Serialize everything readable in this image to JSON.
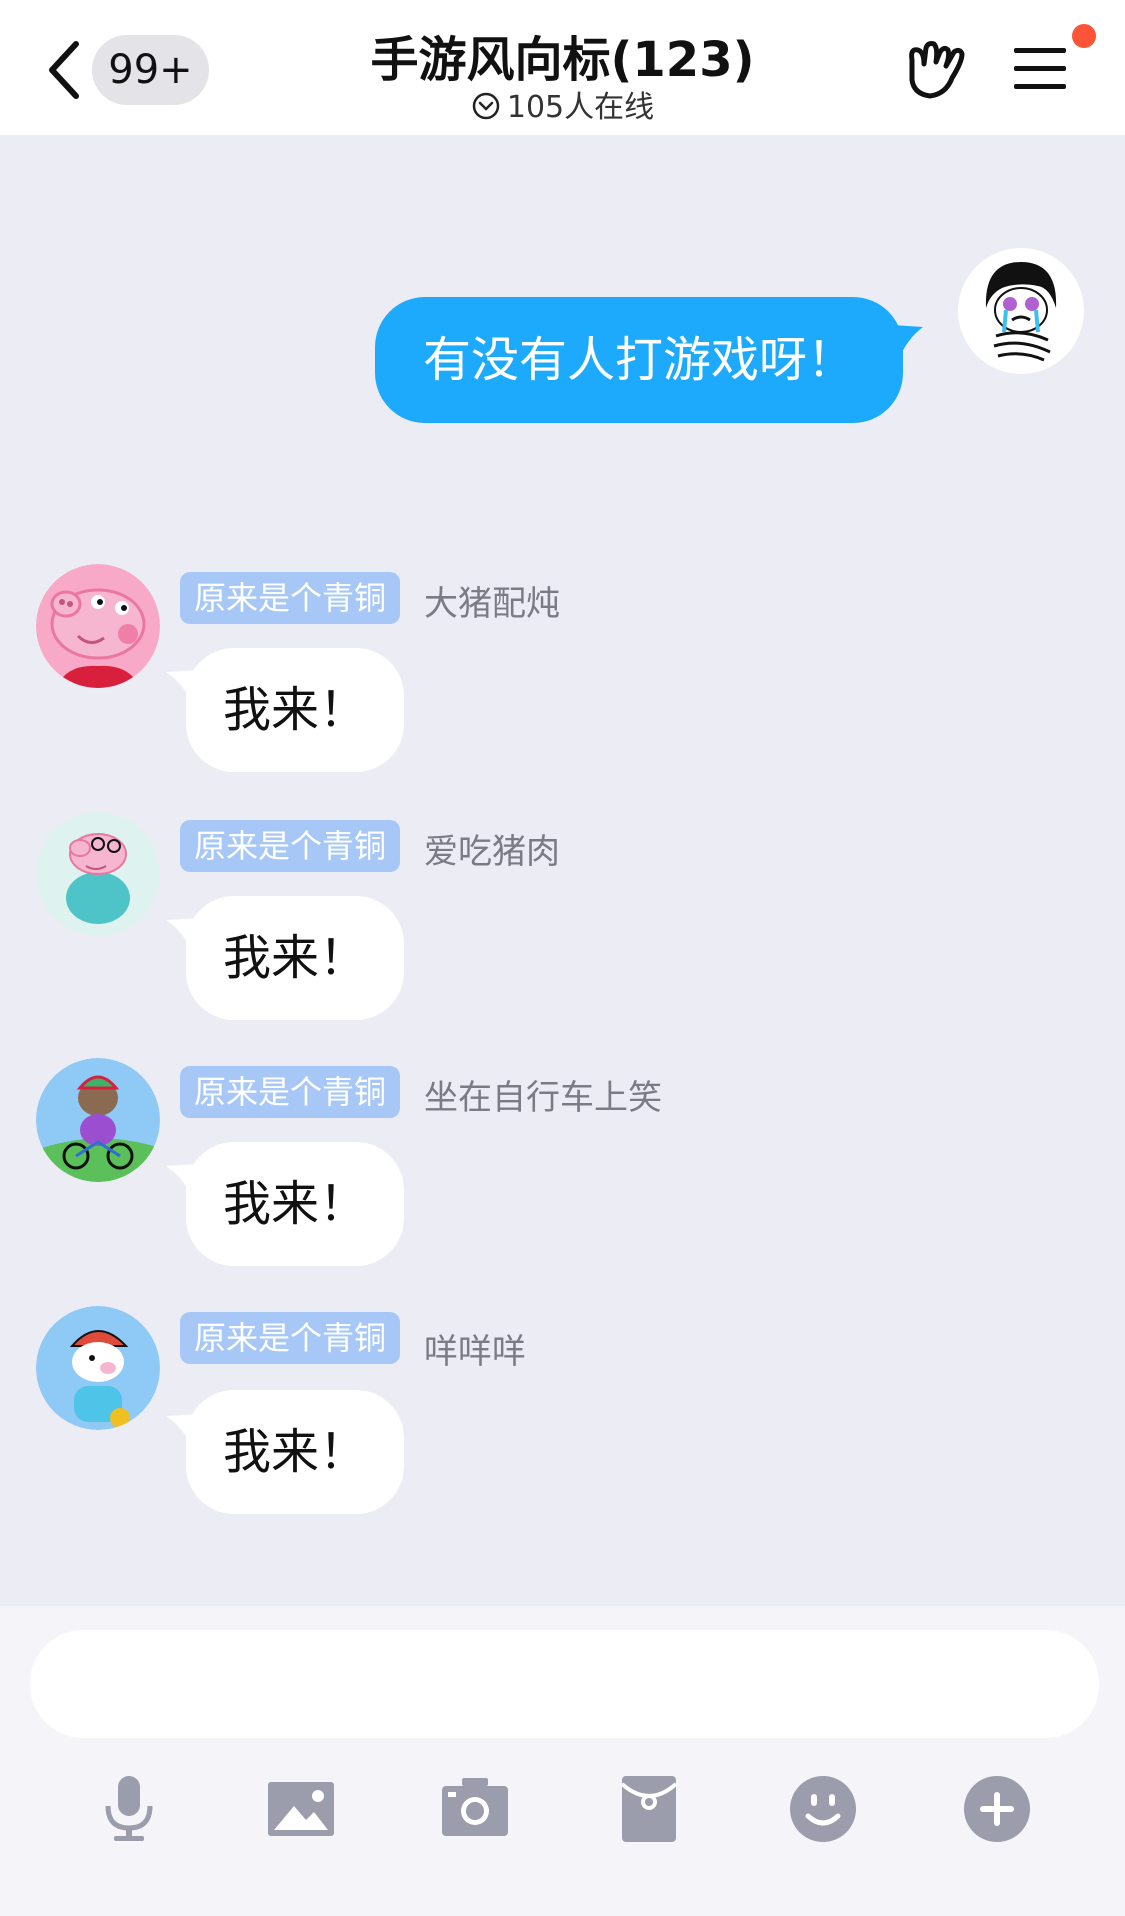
{
  "header": {
    "back_icon": "chevron-left-icon",
    "unread_badge": "99+",
    "title": "手游风向标(123)",
    "online_status": "105人在线",
    "gesture_icon": "rock-hand-icon",
    "menu_icon": "menu-icon",
    "notification_dot_color": "#fb5437"
  },
  "messages": [
    {
      "direction": "outgoing",
      "text": "有没有人打游戏呀！",
      "avatar": "cartoon-face-avatar",
      "bubble_color": "#1daafc"
    },
    {
      "direction": "incoming",
      "tag": "原来是个青铜",
      "sender": "大猪配炖",
      "text": "我来！",
      "avatar": "peppa-pig-avatar"
    },
    {
      "direction": "incoming",
      "tag": "原来是个青铜",
      "sender": "爱吃猪肉",
      "text": "我来！",
      "avatar": "daddy-pig-avatar"
    },
    {
      "direction": "incoming",
      "tag": "原来是个青铜",
      "sender": "坐在自行车上笑",
      "text": "我来！",
      "avatar": "pony-on-bike-avatar"
    },
    {
      "direction": "incoming",
      "tag": "原来是个青铜",
      "sender": "咩咩咩",
      "text": "我来！",
      "avatar": "sheep-helmet-avatar"
    }
  ],
  "input": {
    "value": "",
    "placeholder": ""
  },
  "toolbar": [
    "microphone-icon",
    "image-icon",
    "camera-icon",
    "red-packet-icon",
    "emoji-icon",
    "plus-icon"
  ],
  "colors": {
    "background": "#ececf4",
    "tag": "#a7c8f7",
    "tool_icon": "#9b9cac"
  }
}
